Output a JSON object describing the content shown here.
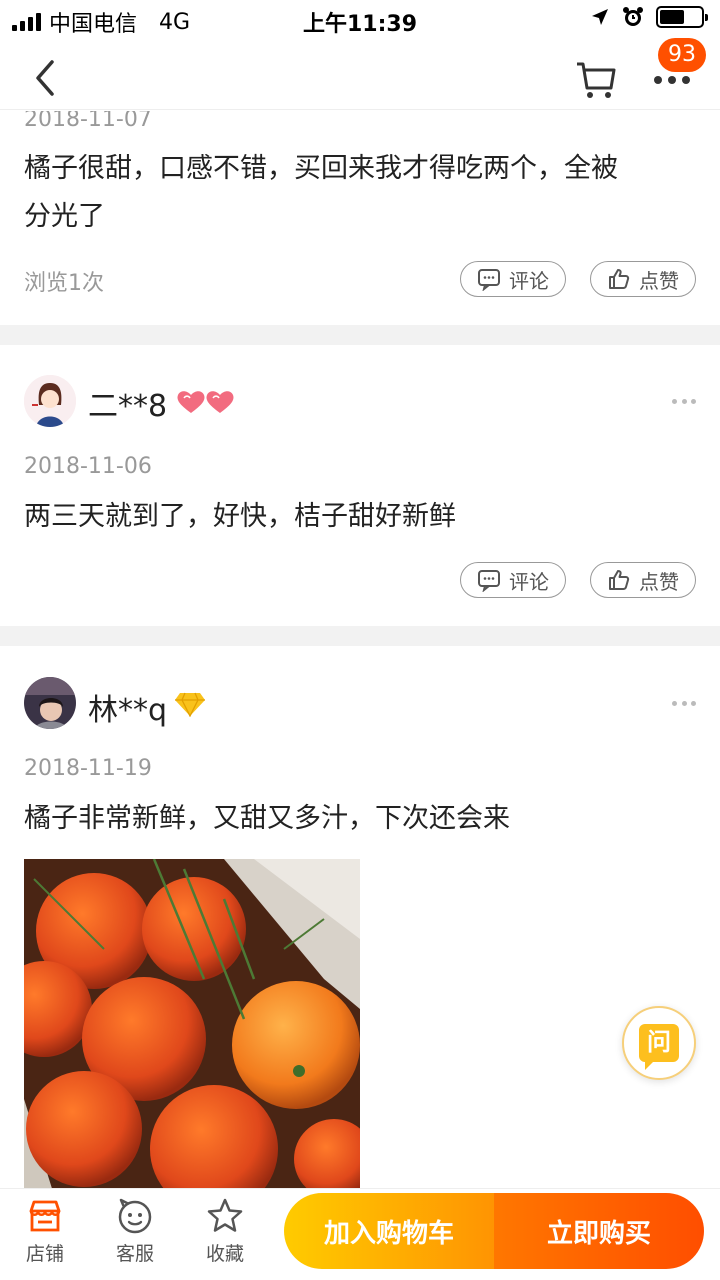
{
  "status_bar": {
    "carrier": "中国电信",
    "network": "4G",
    "time": "上午11:39"
  },
  "nav": {
    "badge_count": "93",
    "back_icon": "chevron-left-icon",
    "cart_icon": "cart-icon",
    "more_icon": "more-dots-icon"
  },
  "reviews": [
    {
      "date": "2018-11-07",
      "text_line1": "橘子很甜，口感不错，买回来我才得吃两个，全被",
      "text_line2": "分光了",
      "views": "浏览1次",
      "comment_label": "评论",
      "like_label": "点赞"
    },
    {
      "username": "二**8",
      "date": "2018-11-06",
      "text": "两三天就到了，好快，桔子甜好新鲜",
      "comment_label": "评论",
      "like_label": "点赞"
    },
    {
      "username": "林**q",
      "date": "2018-11-19",
      "text": "橘子非常新鲜，又甜又多汁，下次还会来"
    }
  ],
  "ask_button": {
    "label": "问"
  },
  "bottom_bar": {
    "shop_label": "店铺",
    "service_label": "客服",
    "favorite_label": "收藏",
    "add_to_cart_label": "加入购物车",
    "buy_now_label": "立即购买"
  },
  "colors": {
    "accent_orange": "#ff5000",
    "cart_button": "#ffb000",
    "buy_button": "#ff5a00",
    "shop_icon": "#ff5000"
  }
}
